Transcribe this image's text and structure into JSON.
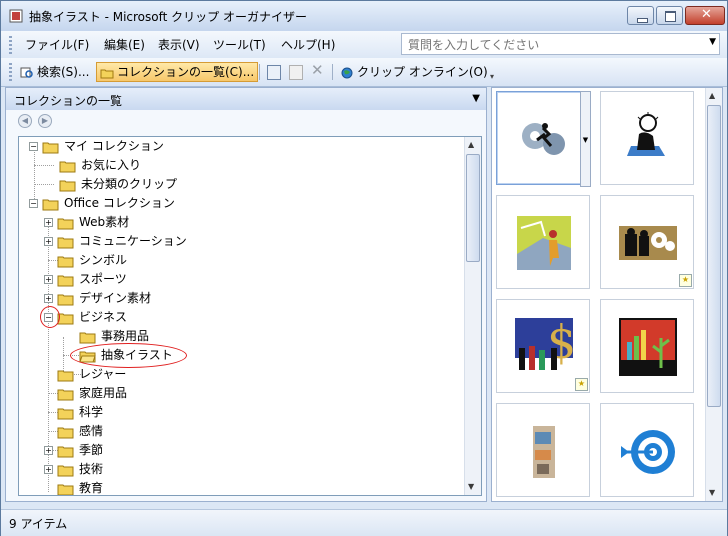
{
  "window": {
    "title": "抽象イラスト - Microsoft クリップ オーガナイザー",
    "app_icon": "clip-organizer-icon",
    "controls": [
      "minimize-icon",
      "maximize-icon",
      "close-icon"
    ]
  },
  "menubar": {
    "items": [
      {
        "label": "ファイル(F)"
      },
      {
        "label": "編集(E)"
      },
      {
        "label": "表示(V)"
      },
      {
        "label": "ツール(T)"
      },
      {
        "label": "ヘルプ(H)"
      }
    ],
    "ask_placeholder": "質問を入力してください"
  },
  "toolbar": {
    "search_label": "検索(S)...",
    "collections_label": "コレクションの一覧(C)...",
    "online_label": "クリップ オンライン(O)"
  },
  "pane": {
    "title": "コレクションの一覧",
    "back_icon": "back-circle-icon",
    "forward_icon": "forward-circle-icon"
  },
  "tree": {
    "nodes": [
      {
        "label": "マイ コレクション",
        "expander": "−"
      },
      {
        "label": "お気に入り"
      },
      {
        "label": "未分類のクリップ"
      },
      {
        "label": "Office コレクション",
        "expander": "−"
      },
      {
        "label": "Web素材",
        "expander": "+"
      },
      {
        "label": "コミュニケーション",
        "expander": "+"
      },
      {
        "label": "シンボル"
      },
      {
        "label": "スポーツ",
        "expander": "+"
      },
      {
        "label": "デザイン素材",
        "expander": "+"
      },
      {
        "label": "ビジネス",
        "expander": "−"
      },
      {
        "label": "事務用品"
      },
      {
        "label": "抽象イラスト"
      },
      {
        "label": "レジャー"
      },
      {
        "label": "家庭用品"
      },
      {
        "label": "科学"
      },
      {
        "label": "感情"
      },
      {
        "label": "季節",
        "expander": "+"
      },
      {
        "label": "技術",
        "expander": "+"
      },
      {
        "label": "教育"
      }
    ]
  },
  "clips": [
    {
      "name": "gears-runner-clip",
      "selected": true
    },
    {
      "name": "lightbulb-thinker-clip"
    },
    {
      "name": "presentation-figure-clip"
    },
    {
      "name": "people-gears-clip",
      "star": true
    },
    {
      "name": "dollar-crowd-clip",
      "star": true
    },
    {
      "name": "bar-chart-plant-clip"
    },
    {
      "name": "abstract-figure-clip"
    },
    {
      "name": "target-arrow-clip"
    }
  ],
  "status": {
    "text": "9 アイテム"
  },
  "colors": {
    "highlight": "#f7c76a",
    "annotation_red": "#e02020",
    "tree_folder": "#f3d25a"
  }
}
